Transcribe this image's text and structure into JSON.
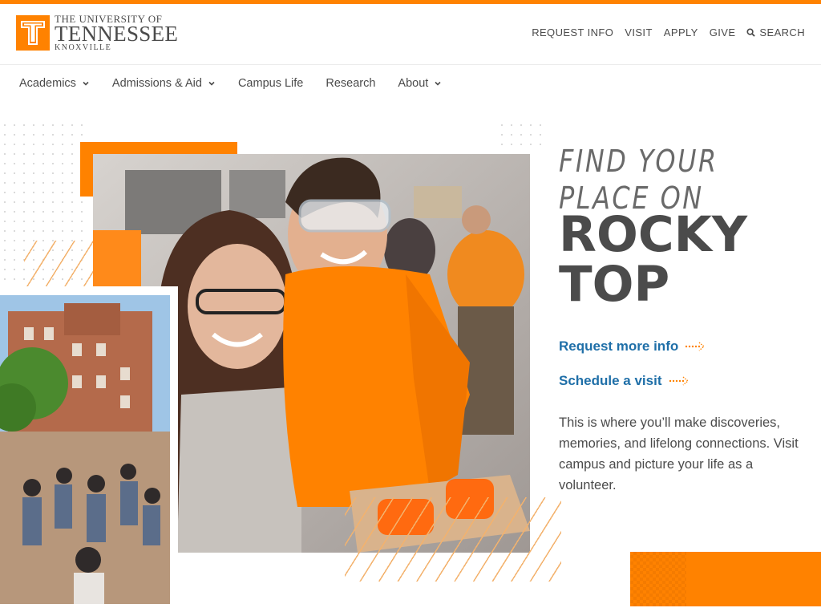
{
  "logo": {
    "line1": "THE UNIVERSITY OF",
    "line2": "TENNESSEE",
    "line3": "KNOXVILLE"
  },
  "utility_nav": [
    {
      "label": "REQUEST INFO"
    },
    {
      "label": "VISIT"
    },
    {
      "label": "APPLY"
    },
    {
      "label": "GIVE"
    }
  ],
  "search": {
    "label": "SEARCH",
    "icon": "search-icon"
  },
  "main_nav": [
    {
      "label": "Academics",
      "has_dropdown": true
    },
    {
      "label": "Admissions & Aid",
      "has_dropdown": true
    },
    {
      "label": "Campus Life",
      "has_dropdown": false
    },
    {
      "label": "Research",
      "has_dropdown": false
    },
    {
      "label": "About",
      "has_dropdown": true
    }
  ],
  "hero": {
    "headline_pre_line1": "FIND YOUR",
    "headline_pre_line2": "PLACE ON",
    "headline_main_line1": "ROCKY",
    "headline_main_line2": "TOP",
    "cta1": "Request more info",
    "cta2": "Schedule a visit",
    "body": "This is where you’ll make discoveries, memories, and lifelong connections. Visit campus and picture your life as a volunteer."
  },
  "colors": {
    "brand_orange": "#ff8200",
    "link_blue": "#1f6fa8",
    "text_gray": "#4b4b4b"
  }
}
